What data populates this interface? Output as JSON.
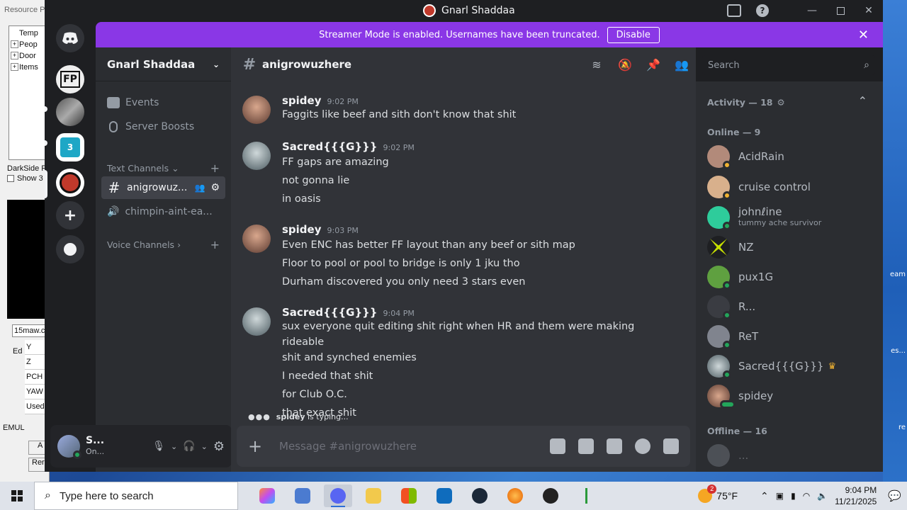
{
  "window": {
    "title": "Gnarl Shaddaa"
  },
  "background": {
    "res_title": "Resource P",
    "tree_items": [
      "Temp",
      "Peop",
      "Door",
      "Items"
    ],
    "darkside": "DarkSide F",
    "show": "Show 3",
    "input_val": "15maw.c",
    "rows": [
      "Y",
      "Z",
      "PCH",
      "YAW"
    ],
    "used": "Used",
    "ed": "Ed",
    "emul": "EMUL",
    "a": "A",
    "rem": "Rer",
    "right_labels": [
      "eam",
      "es...",
      "re"
    ]
  },
  "banner": {
    "text": "Streamer Mode is enabled. Usernames have been truncated.",
    "button": "Disable"
  },
  "server": {
    "name": "Gnarl Shaddaa",
    "events": "Events",
    "boosts": "Server Boosts",
    "text_channels": "Text Channels",
    "voice_channels": "Voice Channels",
    "channels": [
      "anigrowuz...",
      "chimpin-aint-ea..."
    ]
  },
  "user": {
    "name": "S...",
    "status": "On..."
  },
  "channel": {
    "name": "anigrowuzhere"
  },
  "search": {
    "placeholder": "Search"
  },
  "messages": [
    {
      "author": "spidey",
      "time": "9:02 PM",
      "lines": [
        "Faggits like beef and sith don't know that shit"
      ]
    },
    {
      "author": "Sacred{{{G}}}",
      "time": "9:02 PM",
      "lines": [
        "FF gaps are amazing",
        "not gonna lie",
        "in oasis"
      ]
    },
    {
      "author": "spidey",
      "time": "9:03 PM",
      "lines": [
        "Even ENC has better FF layout than any beef or sith map",
        "Floor to pool or pool to bridge is only 1 jku tho",
        "Durham discovered you only need 3 stars even"
      ]
    },
    {
      "author": "Sacred{{{G}}}",
      "time": "9:04 PM",
      "lines": [
        "sux everyone quit editing shit right when HR and them were making rideable",
        "shit and synched enemies",
        "I needed that shit",
        "for Club O.C.",
        "that exact shit"
      ]
    }
  ],
  "typing": {
    "user": "spidey",
    "text": "is typing..."
  },
  "composer": {
    "placeholder": "Message #anigrowuzhere"
  },
  "members": {
    "activity": "Activity — 18",
    "online": "Online — 9",
    "offline": "Offline — 16",
    "list": [
      {
        "name": "AcidRain",
        "sub": ""
      },
      {
        "name": "cruise control",
        "sub": ""
      },
      {
        "name": "johnℓine",
        "sub": "tummy ache survivor"
      },
      {
        "name": "NZ",
        "sub": ""
      },
      {
        "name": "pux1G",
        "sub": ""
      },
      {
        "name": "R...",
        "sub": ""
      },
      {
        "name": "ReT",
        "sub": ""
      },
      {
        "name": "Sacred{{{G}}}",
        "sub": ""
      },
      {
        "name": "spidey",
        "sub": ""
      }
    ],
    "offline_first": "..."
  },
  "taskbar": {
    "search_placeholder": "Type here to search",
    "weather": "75°F",
    "weather_badge": "2",
    "time": "9:04 PM",
    "date": "11/21/2025"
  },
  "colors": {
    "accent": "#5865f2",
    "banner": "#8a37e6",
    "online": "#23a55a"
  }
}
